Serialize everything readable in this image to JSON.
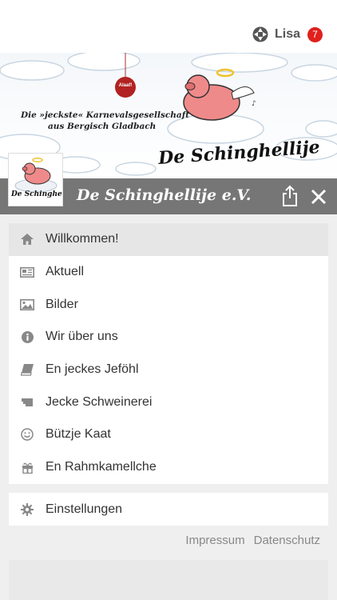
{
  "user": {
    "name": "Lisa",
    "notifications": "7"
  },
  "banner": {
    "tagline_line1": "Die »jeckste« Karnevalsgesellschaft",
    "tagline_line2": "aus Bergisch Gladbach",
    "logo_text": "De Schinghellije",
    "ornament_text": "Alaaf!"
  },
  "header": {
    "title": "De Schinghellije e.V.",
    "avatar_text": "De Schinghellije"
  },
  "menu": {
    "items": [
      {
        "label": "Willkommen!",
        "icon": "home-icon",
        "active": true
      },
      {
        "label": "Aktuell",
        "icon": "newspaper-icon"
      },
      {
        "label": "Bilder",
        "icon": "image-icon"
      },
      {
        "label": "Wir über uns",
        "icon": "info-icon"
      },
      {
        "label": "En jeckes Jeföhl",
        "icon": "book-icon"
      },
      {
        "label": "Jecke Schweinerei",
        "icon": "ticket-icon"
      },
      {
        "label": "Bützje Kaat",
        "icon": "smiley-icon"
      },
      {
        "label": "En Rahmkamellche",
        "icon": "gift-icon"
      }
    ]
  },
  "settings": {
    "label": "Einstellungen",
    "icon": "gear-icon"
  },
  "footer": {
    "impressum": "Impressum",
    "datenschutz": "Datenschutz"
  },
  "colors": {
    "titlebar": "#767676",
    "badge": "#e0201d",
    "active_item": "#e6e6e6"
  }
}
